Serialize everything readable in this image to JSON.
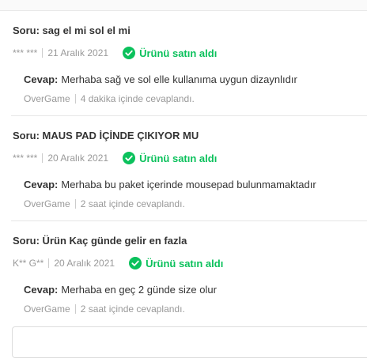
{
  "questions": [
    {
      "question": "Soru: sag el mi sol el mi",
      "author": "*** ***",
      "date": "21 Aralık 2021",
      "verified_label": "Ürünü satın aldı",
      "answer_label": "Cevap:",
      "answer": "Merhaba sağ ve sol elle kullanıma uygun dizaynlıdır",
      "seller": "OverGame",
      "answered_time": "4 dakika içinde cevaplandı."
    },
    {
      "question": "Soru: MAUS PAD İÇİNDE ÇIKIYOR MU",
      "author": "*** ***",
      "date": "20 Aralık 2021",
      "verified_label": "Ürünü satın aldı",
      "answer_label": "Cevap:",
      "answer": "Merhaba bu paket içerinde mousepad bulunmamaktadır",
      "seller": "OverGame",
      "answered_time": "2 saat içinde cevaplandı."
    },
    {
      "question": "Soru: Ürün Kaç günde gelir en fazla",
      "author": "K** G**",
      "date": "20 Aralık 2021",
      "verified_label": "Ürünü satın aldı",
      "answer_label": "Cevap:",
      "answer": "Merhaba en geç 2 günde size olur",
      "seller": "OverGame",
      "answered_time": "2 saat içinde cevaplandı."
    }
  ],
  "colors": {
    "verified": "#0bc15c",
    "muted": "#999999",
    "text": "#333333"
  },
  "icons": {
    "verified": "check-circle-icon"
  }
}
